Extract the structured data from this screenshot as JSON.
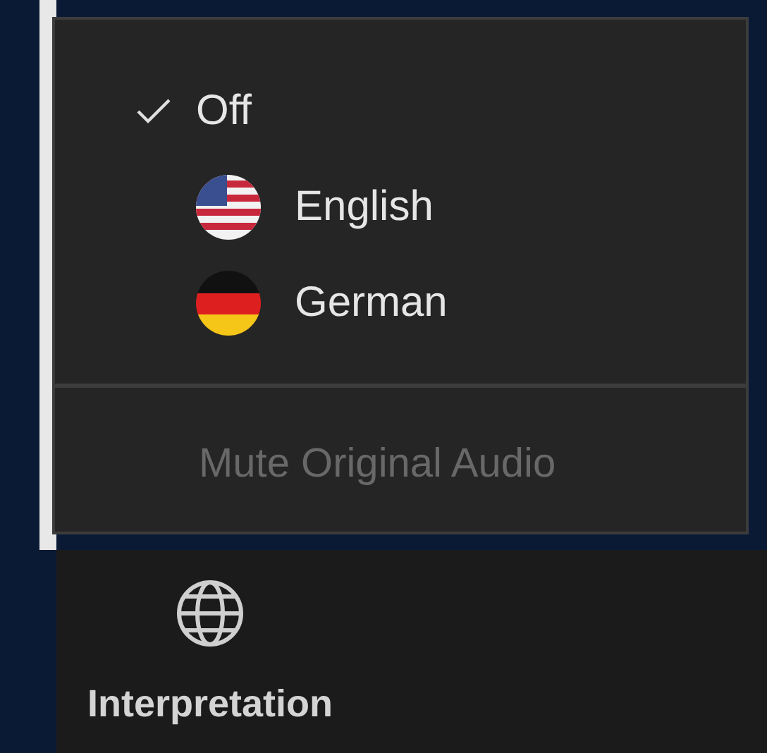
{
  "menu": {
    "items": [
      {
        "kind": "plain",
        "label": "Off",
        "selected": true
      },
      {
        "kind": "usflag",
        "label": "English",
        "selected": false
      },
      {
        "kind": "deflag",
        "label": "German",
        "selected": false
      }
    ],
    "mute_item": {
      "label": "Mute Original Audio",
      "disabled": true
    }
  },
  "toolbar": {
    "button": {
      "label": "Interpretation"
    }
  }
}
